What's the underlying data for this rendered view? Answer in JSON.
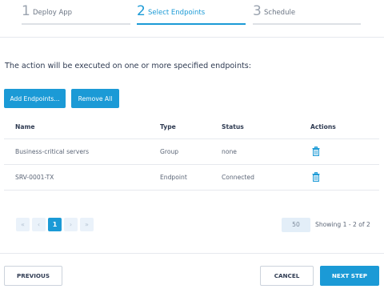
{
  "wizard": {
    "steps": [
      {
        "number": "1",
        "label": "Deploy App"
      },
      {
        "number": "2",
        "label": "Select Endpoints"
      },
      {
        "number": "3",
        "label": "Schedule"
      }
    ],
    "active_step": 2
  },
  "description": "The action will be executed on one or more specified endpoints:",
  "toolbar": {
    "add_label": "Add Endpoints...",
    "remove_label": "Remove All"
  },
  "table": {
    "columns": [
      "Name",
      "Type",
      "Status",
      "Actions"
    ],
    "rows": [
      {
        "name": "Business-critical servers",
        "type": "Group",
        "status": "none",
        "action_icon": "trash-icon"
      },
      {
        "name": "SRV-0001-TX",
        "type": "Endpoint",
        "status": "Connected",
        "action_icon": "trash-icon"
      }
    ]
  },
  "pagination": {
    "first_icon": "first-page-icon",
    "prev_icon": "prev-page-icon",
    "current_page": "1",
    "next_icon": "next-page-icon",
    "last_icon": "last-page-icon",
    "per_page": "50",
    "showing": "Showing 1 - 2 of 2"
  },
  "footer": {
    "previous_label": "PREVIOUS",
    "cancel_label": "CANCEL",
    "next_label": "NEXT STEP"
  },
  "colors": {
    "accent": "#1b9ad6",
    "text": "#2f3b52",
    "muted": "#5c6677"
  }
}
